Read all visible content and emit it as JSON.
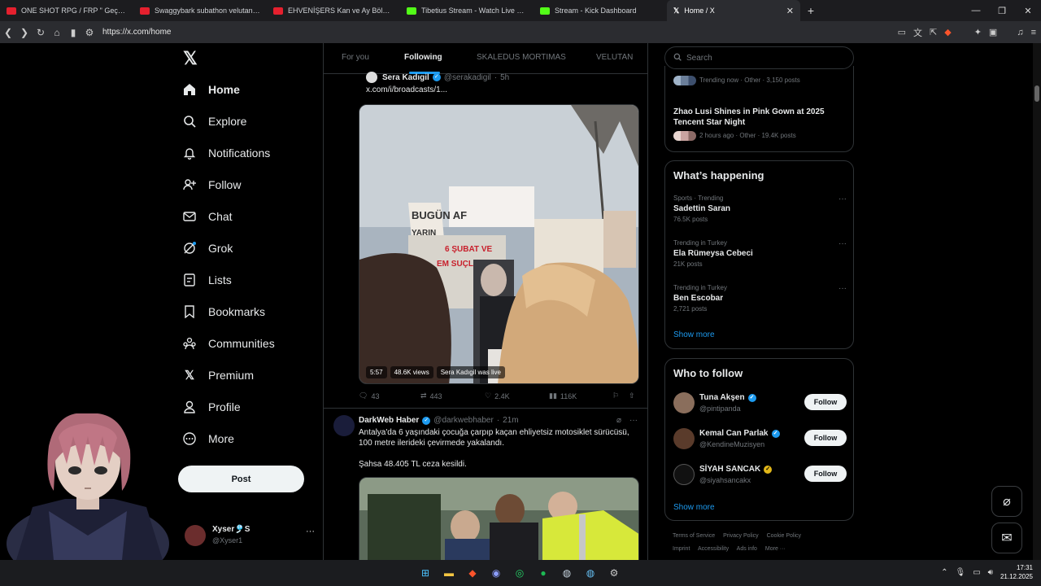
{
  "browser": {
    "tabs": [
      {
        "title": "ONE SHOT RPG / FRP \" Geçmişin Yar",
        "color": "#e5202e"
      },
      {
        "title": "Swaggybark subathon velutan editio",
        "color": "#e5202e"
      },
      {
        "title": "EHVENİŞERS Kan ve Ay Bölüm #1 - Y",
        "color": "#e5202e"
      },
      {
        "title": "Tibetius Stream - Watch Live on Kick",
        "color": "#53fc18"
      },
      {
        "title": "Stream - Kick Dashboard",
        "color": "#53fc18"
      },
      {
        "title": "Home / X",
        "color": "#ffffff"
      }
    ],
    "url": "https://x.com/home"
  },
  "nav": {
    "items": [
      {
        "label": "Home",
        "icon": "home-icon"
      },
      {
        "label": "Explore",
        "icon": "search-icon"
      },
      {
        "label": "Notifications",
        "icon": "bell-icon"
      },
      {
        "label": "Follow",
        "icon": "add-user-icon"
      },
      {
        "label": "Chat",
        "icon": "mail-icon"
      },
      {
        "label": "Grok",
        "icon": "grok-icon"
      },
      {
        "label": "Lists",
        "icon": "list-icon"
      },
      {
        "label": "Bookmarks",
        "icon": "bookmark-icon"
      },
      {
        "label": "Communities",
        "icon": "communities-icon"
      },
      {
        "label": "Premium",
        "icon": "x-icon"
      },
      {
        "label": "Profile",
        "icon": "profile-icon"
      },
      {
        "label": "More",
        "icon": "more-icon"
      }
    ],
    "post_label": "Post",
    "account": {
      "name": "Xyser🎐S",
      "handle": "@Xyser1"
    }
  },
  "feed_tabs": [
    "For you",
    "Following",
    "SKALEDUS MORTIMAS",
    "VELUTAN"
  ],
  "tweet1": {
    "name": "Sera Kadıgil",
    "handle": "@serakadigil",
    "time": "5h",
    "text": "x.com/i/broadcasts/1...",
    "video_duration": "5:57",
    "video_views": "48.6K views",
    "video_status": "Sera Kadıgil was live",
    "sign_text_1": "BUGÜN AF",
    "sign_text_2": "YARIN",
    "sign_text_3": "6 ŞUBAT VE",
    "sign_text_4": "EM SUÇLULARI",
    "replies": "43",
    "reposts": "443",
    "likes": "2.4K",
    "views": "116K"
  },
  "tweet2": {
    "name": "DarkWeb Haber",
    "handle": "@darkwebhaber",
    "time": "21m",
    "line1": "Antalya'da 6 yaşındaki çocuğa çarpıp kaçan ehliyetsiz motosiklet sürücüsü,",
    "line2": "100 metre ilerideki çevirmede yakalandı.",
    "line3": "Şahsa 48.405 TL ceza kesildi."
  },
  "right": {
    "search_placeholder": "Search",
    "top_trend_meta": "Trending now · Other · 3,150 posts",
    "news_title": "Zhao Lusi Shines in Pink Gown at 2025 Tencent Star Night",
    "news_meta": "2 hours ago · Other · 19.4K posts",
    "happening_title": "What’s happening",
    "trends": [
      {
        "meta": "Sports · Trending",
        "title": "Sadettin Saran",
        "posts": "76.5K posts"
      },
      {
        "meta": "Trending in Turkey",
        "title": "Ela Rümeysa Cebeci",
        "posts": "21K posts"
      },
      {
        "meta": "Trending in Turkey",
        "title": "Ben Escobar",
        "posts": "2,721 posts"
      }
    ],
    "show_more": "Show more",
    "wtf_title": "Who to follow",
    "follow": [
      {
        "name": "Tuna Akşen",
        "handle": "@pintipanda",
        "badge": "blue"
      },
      {
        "name": "Kemal Can Parlak",
        "handle": "@KendineMuzisyen",
        "badge": "blue"
      },
      {
        "name": "SİYAH SANCAK",
        "handle": "@siyahsancakx",
        "badge": "gold"
      }
    ],
    "follow_label": "Follow",
    "footer": [
      "Terms of Service",
      "Privacy Policy",
      "Cookie Policy",
      "Imprint",
      "Accessibility",
      "Ads info",
      "More ···"
    ]
  },
  "taskbar": {
    "time": "17:31",
    "date": "21.12.2025"
  }
}
